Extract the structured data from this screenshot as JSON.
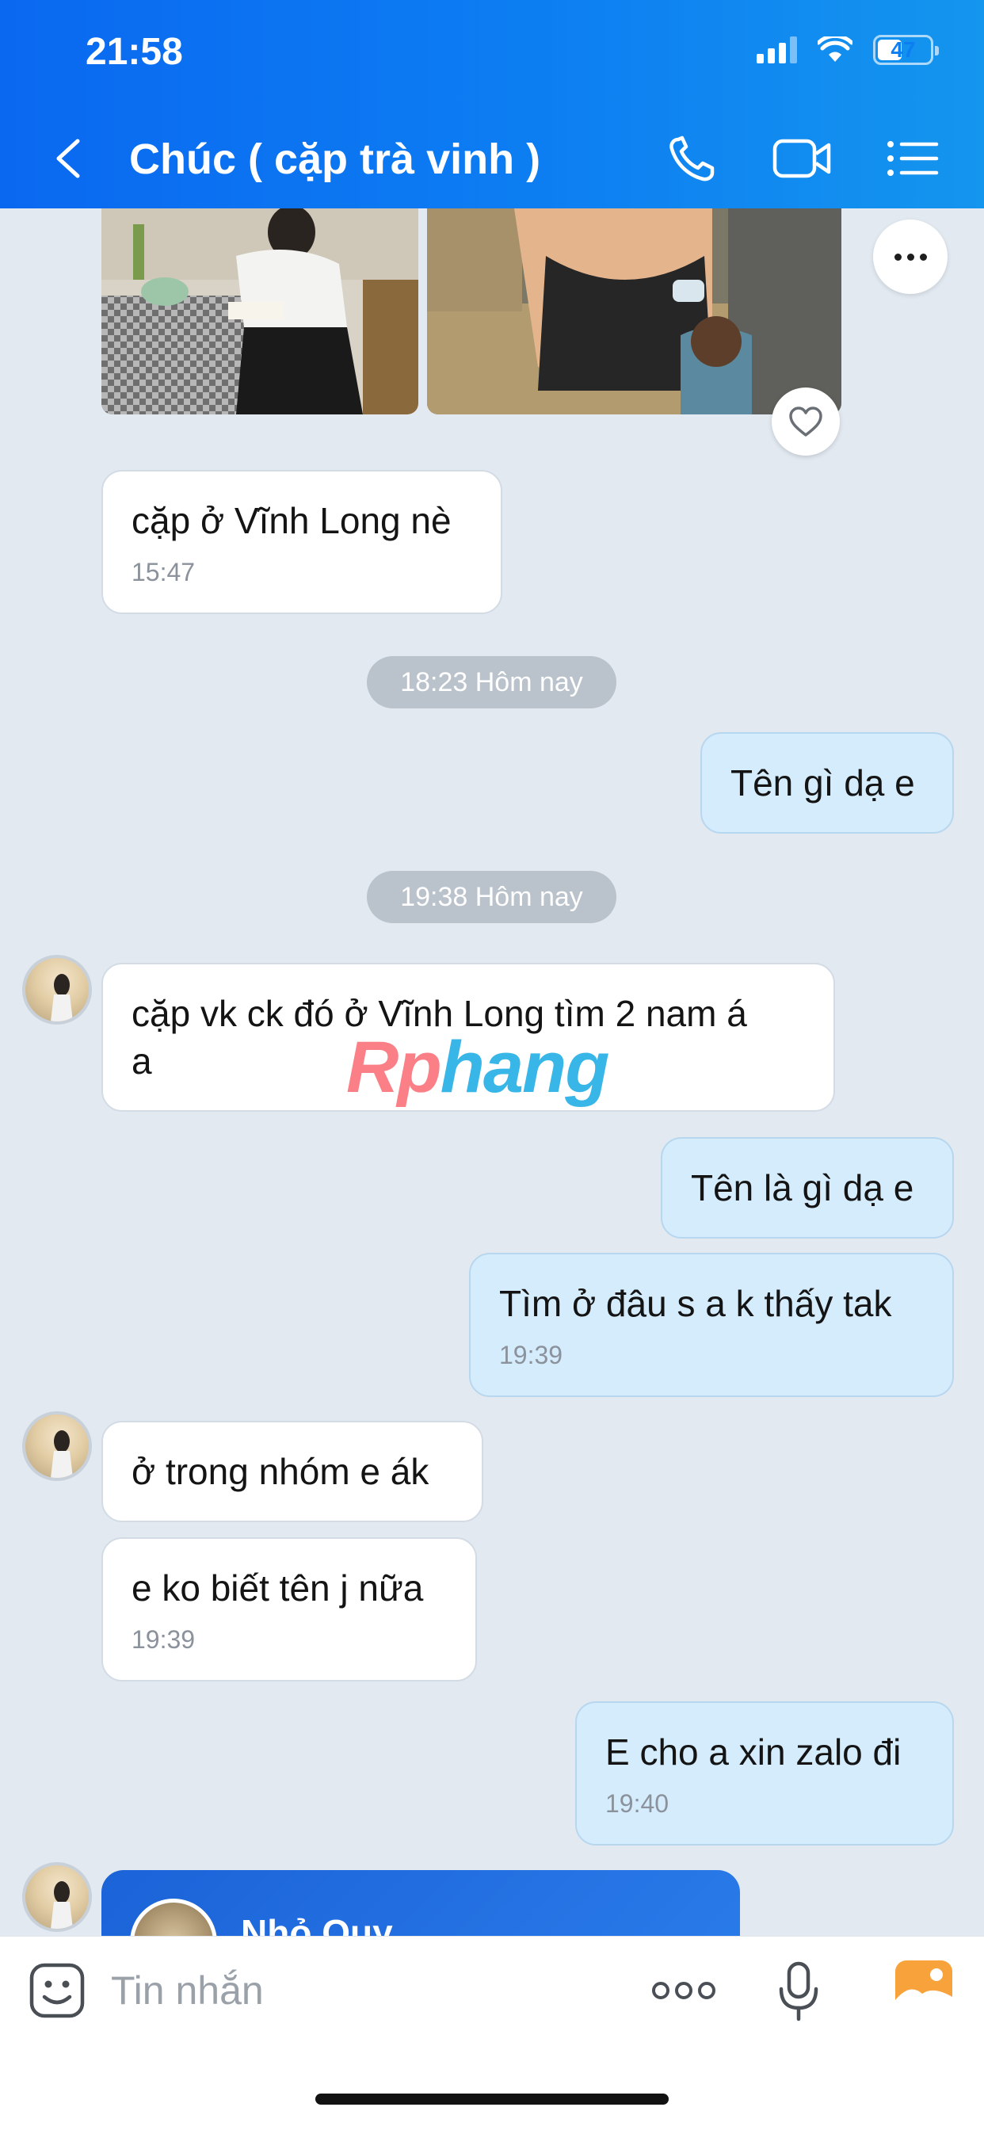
{
  "status_bar": {
    "time": "21:58",
    "battery": "47",
    "battery_level": 0.47
  },
  "header": {
    "title": "Chúc ( cặp trà vinh )",
    "icons": [
      "back-arrow-icon",
      "phone-icon",
      "video-call-icon",
      "menu-list-icon"
    ]
  },
  "messages": [
    {
      "direction": "in",
      "text": "cặp ở Vĩnh Long nè",
      "time": "15:47"
    },
    {
      "type": "separator",
      "text": "18:23 Hôm nay"
    },
    {
      "direction": "out",
      "text": "Tên gì dạ e"
    },
    {
      "type": "separator",
      "text": "19:38 Hôm nay"
    },
    {
      "direction": "in",
      "text": "cặp vk ck đó ở Vĩnh Long tìm 2 nam á\na"
    },
    {
      "direction": "out",
      "text": "Tên là gì dạ e"
    },
    {
      "direction": "out",
      "text": "Tìm ở đâu s a k thấy tak",
      "time": "19:39"
    },
    {
      "direction": "in",
      "text": "ở trong nhóm e ák"
    },
    {
      "direction": "in",
      "text": "e ko biết tên j nữa",
      "time": "19:39"
    },
    {
      "direction": "out",
      "text": "E cho a xin zalo đi",
      "time": "19:40"
    }
  ],
  "contact_card": {
    "name": "Nhỏ Quy"
  },
  "watermark": {
    "part1": "Rp",
    "part2": "hang"
  },
  "input": {
    "placeholder": "Tin nhắn"
  },
  "colors": {
    "header_blue": "#0d7ef2",
    "outgoing_bubble": "#d5ecfd",
    "chat_bg": "#e2e9f1",
    "image_button": "#f7a23a"
  }
}
